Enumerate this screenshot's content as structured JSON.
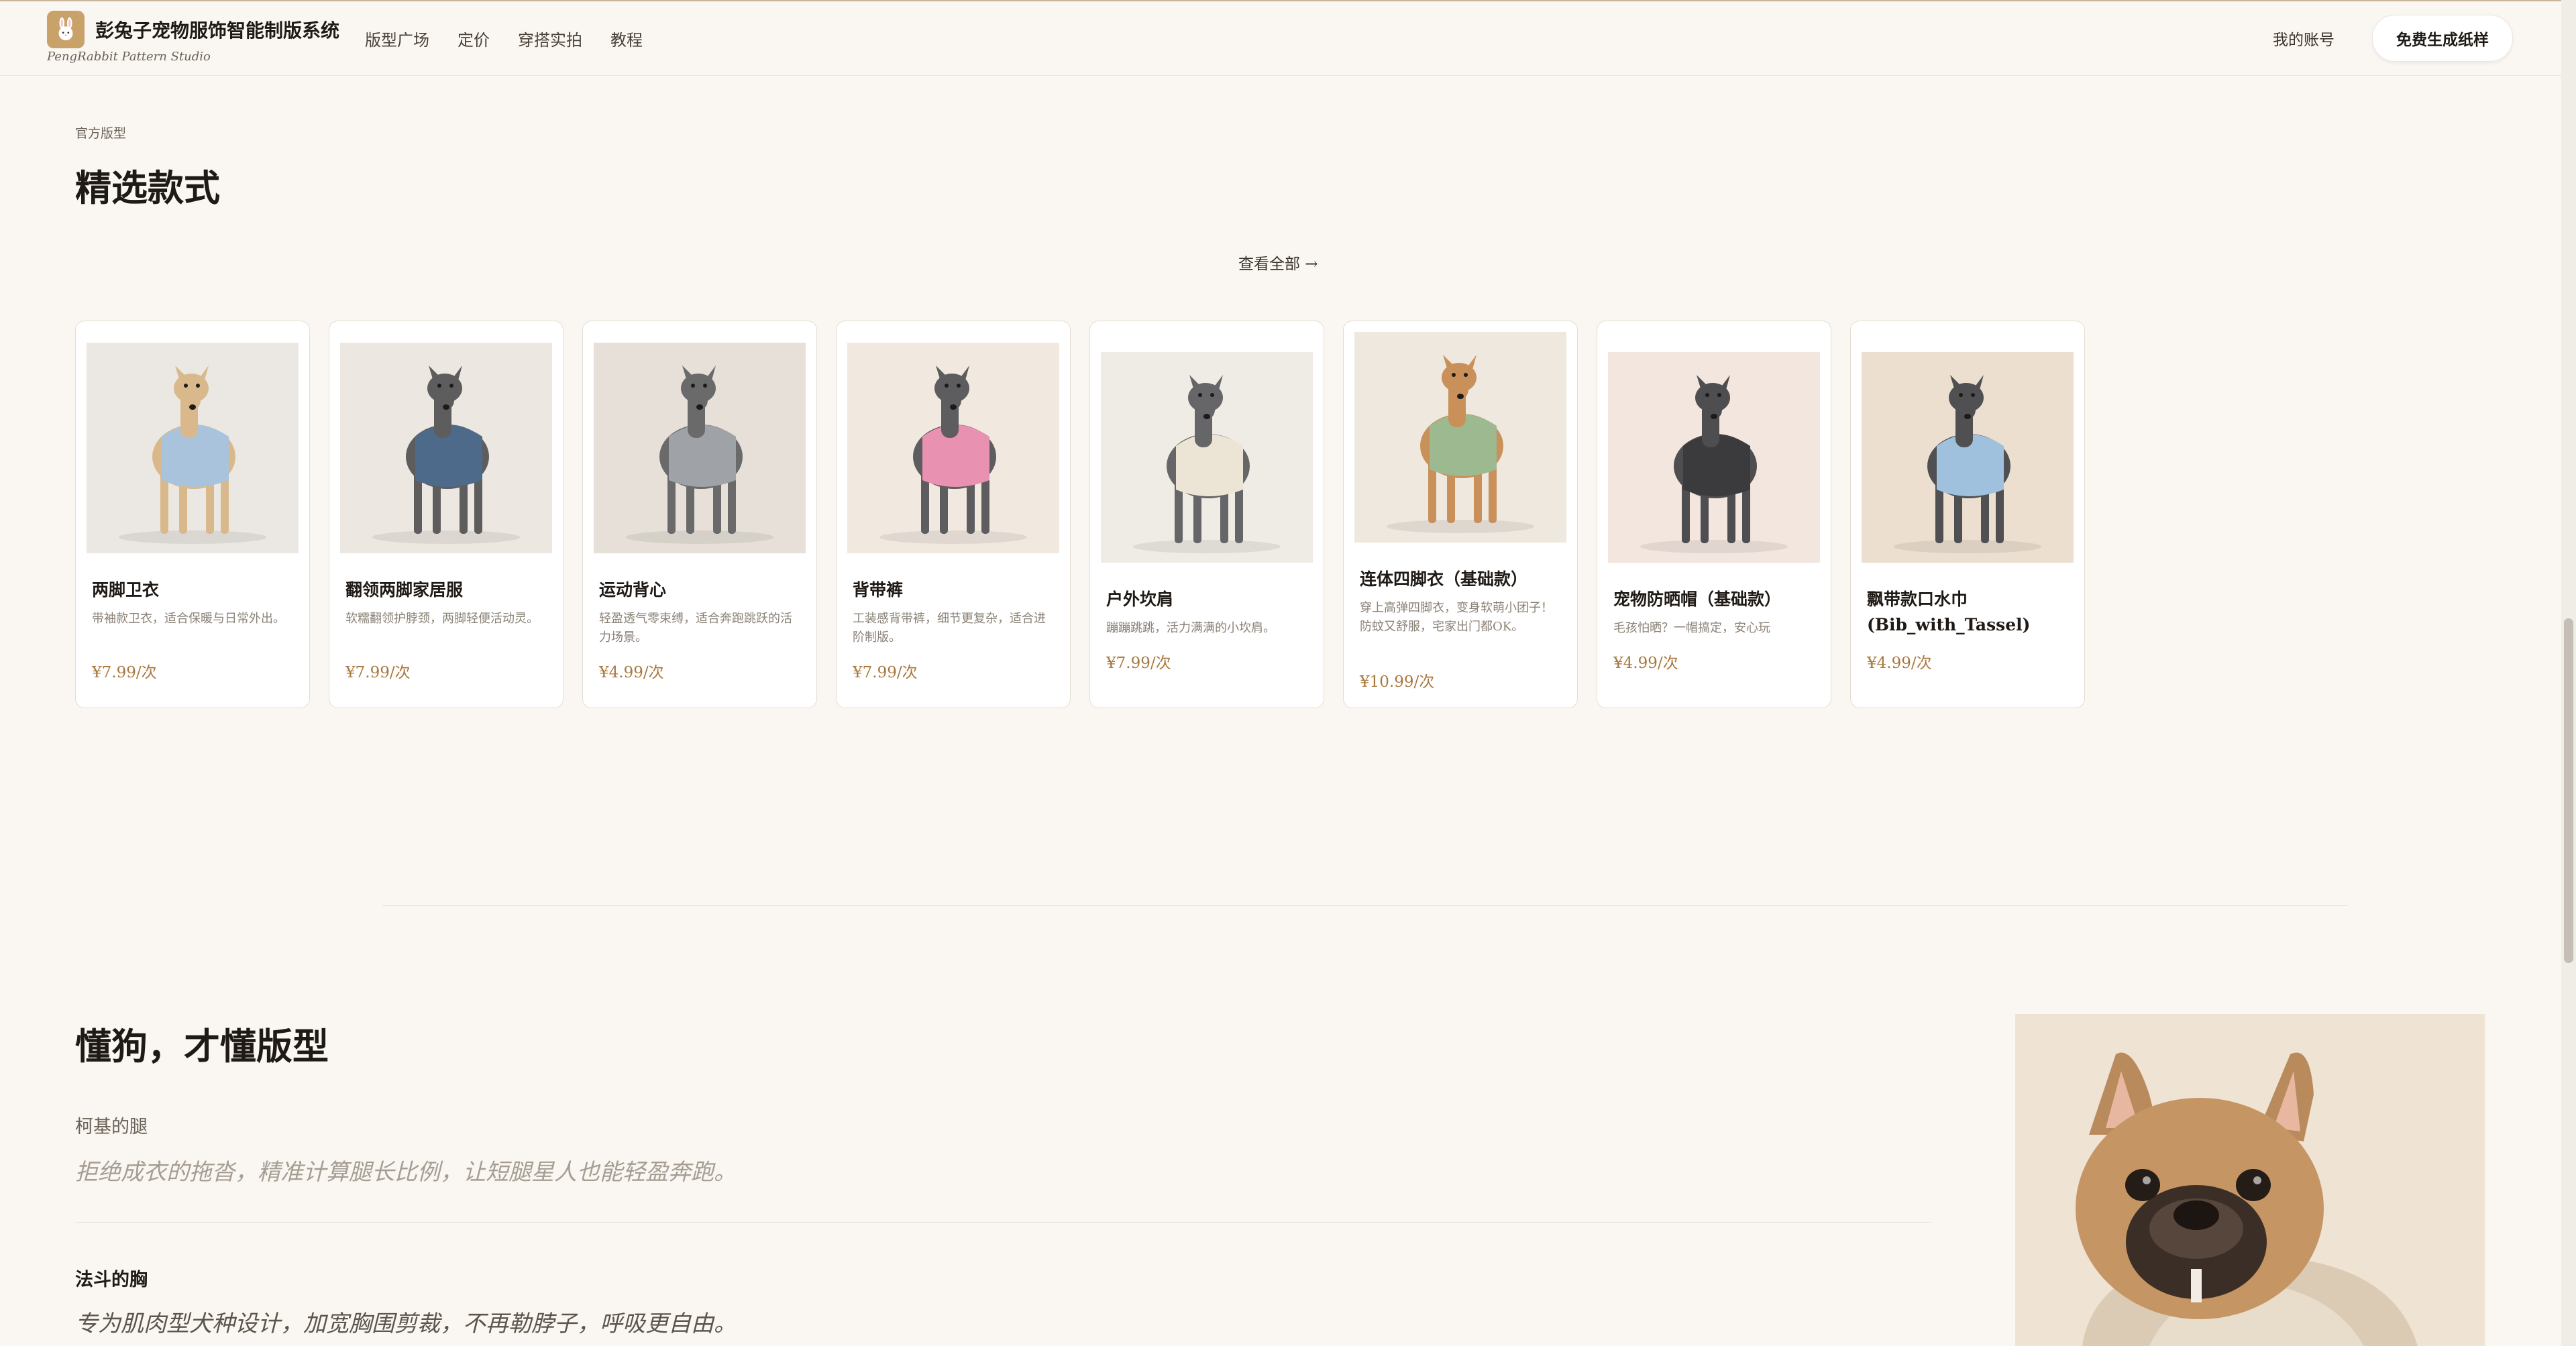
{
  "brand": {
    "title": "彭兔子宠物服饰智能制版系统",
    "subtitle": "PengRabbit Pattern Studio",
    "logo_icon": "rabbit-icon"
  },
  "nav": {
    "items": [
      "版型广场",
      "定价",
      "穿搭实拍",
      "教程"
    ],
    "account": "我的账号",
    "cta": "免费生成纸样"
  },
  "featured": {
    "eyebrow": "官方版型",
    "title": "精选款式",
    "view_all": "查看全部 →"
  },
  "products": [
    {
      "name": "两脚卫衣",
      "desc": "带袖款卫衣，适合保暖与日常外出。",
      "price": "¥7.99/次",
      "bg": "#ebe8e3",
      "dog": "#d9b98c",
      "garment": "#a9c3dc"
    },
    {
      "name": "翻领两脚家居服",
      "desc": "软糯翻领护脖颈，两脚轻便活动灵。",
      "price": "¥7.99/次",
      "bg": "#ece7e0",
      "dog": "#5e5d5e",
      "garment": "#4d6a8a"
    },
    {
      "name": "运动背心",
      "desc": "轻盈透气零束缚，适合奔跑跳跃的活力场景。",
      "price": "¥4.99/次",
      "bg": "#e6e0d8",
      "dog": "#6b6a6b",
      "garment": "#9fa2a6"
    },
    {
      "name": "背带裤",
      "desc": "工装感背带裤，细节更复杂，适合进阶制版。",
      "price": "¥7.99/次",
      "bg": "#f1e9e0",
      "dog": "#5d5c5e",
      "garment": "#e891b0"
    },
    {
      "name": "户外坎肩",
      "desc": "蹦蹦跳跳，活力满满的小坎肩。",
      "price": "¥7.99/次",
      "bg": "#efebe5",
      "dog": "#666567",
      "garment": "#ece5d6"
    },
    {
      "name": "连体四脚衣（基础款）",
      "desc": "穿上高弹四脚衣，变身软萌小团子！防蚊又舒服，宅家出门都OK。",
      "price": "¥10.99/次",
      "bg": "#eee8df",
      "dog": "#c9905a",
      "garment": "#9cb98f"
    },
    {
      "name": "宠物防晒帽（基础款）",
      "desc": "毛孩怕晒？一帽搞定，安心玩",
      "price": "¥4.99/次",
      "bg": "#f3e6df",
      "dog": "#4e4d4f",
      "garment": "#3b3a3c"
    },
    {
      "name": "飘带款口水巾(Bib_with_Tassel)",
      "desc": "",
      "price": "¥4.99/次",
      "bg": "#ecdfd0",
      "dog": "#505052",
      "garment": "#9fc1de"
    }
  ],
  "why": {
    "title": "懂狗，才懂版型",
    "features": [
      {
        "label": "柯基的腿",
        "text": "拒绝成衣的拖沓，精准计算腿长比例，让短腿星人也能轻盈奔跑。"
      },
      {
        "label": "法斗的胸",
        "text": "专为肌肉型犬种设计，加宽胸围剪裁，不再勒脖子，呼吸更自由。"
      }
    ]
  },
  "colors": {
    "accent": "#a8773d",
    "background": "#faf7f2",
    "logo": "#c9a26a"
  }
}
